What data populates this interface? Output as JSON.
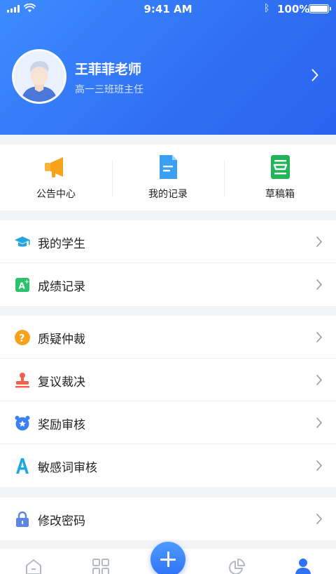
{
  "status_bar": {
    "time": "9:41 AM",
    "battery": "100%"
  },
  "profile": {
    "name": "王菲菲老师",
    "role": "高一三班班主任"
  },
  "quick_actions": [
    {
      "label": "公告中心",
      "icon": "megaphone-icon",
      "color": "#f7a21b"
    },
    {
      "label": "我的记录",
      "icon": "document-icon",
      "color": "#3aa0f5"
    },
    {
      "label": "草稿箱",
      "icon": "draft-box-icon",
      "color": "#21b55a"
    }
  ],
  "menu_group_1": [
    {
      "label": "我的学生",
      "icon": "graduation-cap-icon"
    },
    {
      "label": "成绩记录",
      "icon": "grade-a-plus-icon"
    }
  ],
  "menu_group_2": [
    {
      "label": "质疑仲裁",
      "icon": "question-icon"
    },
    {
      "label": "复议裁决",
      "icon": "stamp-icon"
    },
    {
      "label": "奖励审核",
      "icon": "alarm-clock-icon"
    },
    {
      "label": "敏感词审核",
      "icon": "letter-a-icon"
    }
  ],
  "menu_group_3": [
    {
      "label": "修改密码",
      "icon": "lock-icon"
    }
  ],
  "tab_bar": {
    "tabs": [
      "home-icon",
      "grid-icon",
      "add-icon",
      "pie-chart-icon",
      "profile-icon"
    ],
    "active": "profile-icon",
    "accent": "#2f72f5"
  }
}
